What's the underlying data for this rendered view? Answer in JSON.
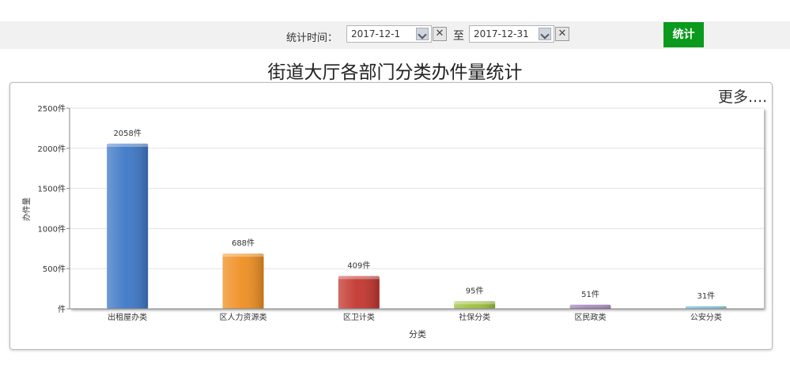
{
  "filter": {
    "label": "统计时间：",
    "start_date": "2017-12-1",
    "end_date": "2017-12-31",
    "to_label": "至",
    "clear_glyph": "✕",
    "submit_label": "统计"
  },
  "more_link": "更多....",
  "colors": {
    "accent_green": "#0a9a1c",
    "grid": "#e3e3e3"
  },
  "chart_data": {
    "type": "bar",
    "title": "街道大厅各部门分类办件量统计",
    "xlabel": "分类",
    "ylabel": "办件量",
    "ylim": [
      0,
      2500
    ],
    "yticks": [
      "件",
      "500件",
      "1000件",
      "1500件",
      "2000件",
      "2500件"
    ],
    "ytick_values": [
      0,
      500,
      1000,
      1500,
      2000,
      2500
    ],
    "grid": true,
    "categories": [
      "出租屋办类",
      "区人力资源类",
      "区卫计类",
      "社保分类",
      "区民政类",
      "公安分类"
    ],
    "values": [
      2058,
      688,
      409,
      95,
      51,
      31
    ],
    "value_labels": [
      "2058件",
      "688件",
      "409件",
      "95件",
      "51件",
      "31件"
    ],
    "bar_colors": [
      "#3d78c6",
      "#ef8f23",
      "#c3362f",
      "#9cc03b",
      "#7d4f9c",
      "#3aa8c9"
    ]
  }
}
